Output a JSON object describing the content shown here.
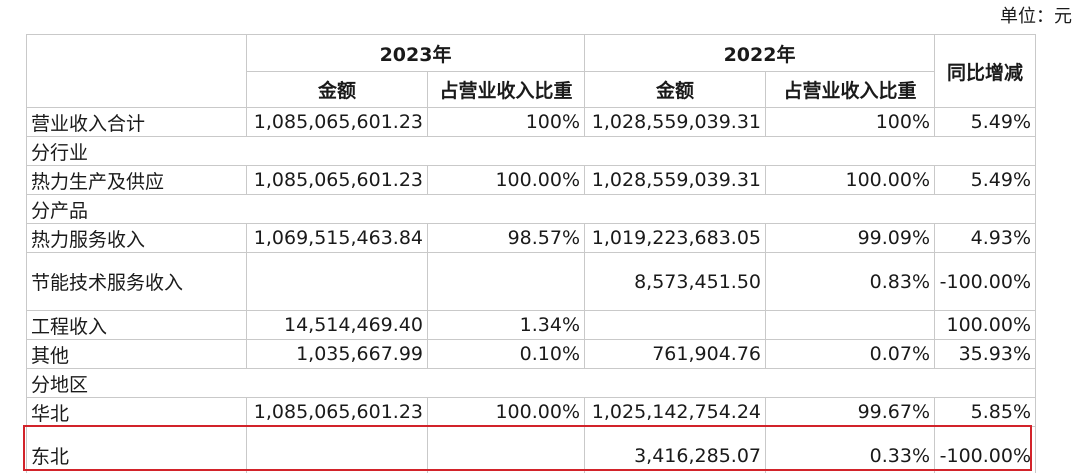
{
  "unit_label": "单位：元",
  "header": {
    "year_2023": "2023年",
    "year_2022": "2022年",
    "yoy": "同比增减",
    "amount": "金额",
    "share": "占营业收入比重"
  },
  "rows": {
    "total": {
      "label": "营业收入合计",
      "a2023": "1,085,065,601.23",
      "s2023": "100%",
      "a2022": "1,028,559,039.31",
      "s2022": "100%",
      "yoy": "5.49%"
    },
    "sec_industry": {
      "label": "分行业"
    },
    "heat_supply": {
      "label": "热力生产及供应",
      "a2023": "1,085,065,601.23",
      "s2023": "100.00%",
      "a2022": "1,028,559,039.31",
      "s2022": "100.00%",
      "yoy": "5.49%"
    },
    "sec_product": {
      "label": "分产品"
    },
    "heat_service": {
      "label": "热力服务收入",
      "a2023": "1,069,515,463.84",
      "s2023": "98.57%",
      "a2022": "1,019,223,683.05",
      "s2022": "99.09%",
      "yoy": "4.93%"
    },
    "energy_saving": {
      "label": "节能技术服务收入",
      "a2023": "",
      "s2023": "",
      "a2022": "8,573,451.50",
      "s2022": "0.83%",
      "yoy": "-100.00%"
    },
    "engineering": {
      "label": "工程收入",
      "a2023": "14,514,469.40",
      "s2023": "1.34%",
      "a2022": "",
      "s2022": "",
      "yoy": "100.00%"
    },
    "other": {
      "label": "其他",
      "a2023": "1,035,667.99",
      "s2023": "0.10%",
      "a2022": "761,904.76",
      "s2022": "0.07%",
      "yoy": "35.93%"
    },
    "sec_region": {
      "label": "分地区"
    },
    "north_china": {
      "label": "华北",
      "a2023": "1,085,065,601.23",
      "s2023": "100.00%",
      "a2022": "1,025,142,754.24",
      "s2022": "99.67%",
      "yoy": "5.85%"
    },
    "northeast": {
      "label": "东北",
      "a2023": "",
      "s2023": "",
      "a2022": "3,416,285.07",
      "s2022": "0.33%",
      "yoy": "-100.00%"
    }
  },
  "colors": {
    "highlight": "#d2232a",
    "border": "#c9c9c9"
  }
}
